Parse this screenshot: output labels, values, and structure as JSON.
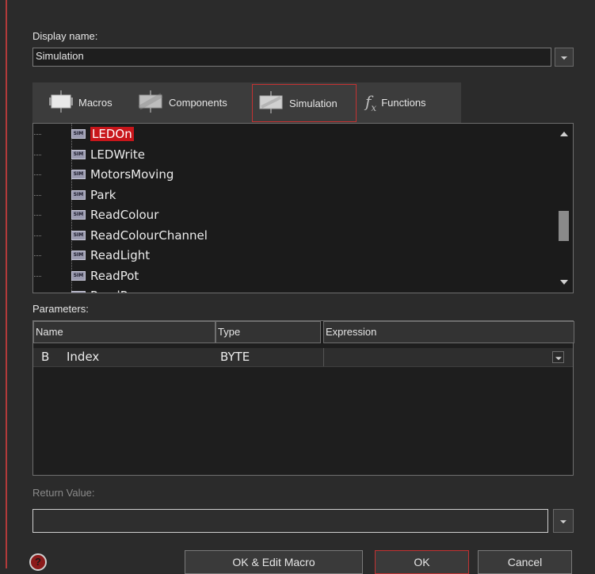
{
  "display_name": {
    "label": "Display name:",
    "value": "Simulation"
  },
  "tabs": [
    {
      "label": "Macros",
      "icon": "macros-icon"
    },
    {
      "label": "Components",
      "icon": "components-icon"
    },
    {
      "label": "Simulation",
      "icon": "simulation-icon",
      "active": true
    },
    {
      "label": "Functions",
      "icon": "functions-icon"
    }
  ],
  "tree": {
    "icon_text": "SIM",
    "items": [
      "LEDOn",
      "LEDWrite",
      "MotorsMoving",
      "Park",
      "ReadColour",
      "ReadColourChannel",
      "ReadLight",
      "ReadPot",
      "ReadProx"
    ],
    "selected": "LEDOn"
  },
  "parameters": {
    "label": "Parameters:",
    "columns": [
      "Name",
      "Type",
      "Expression"
    ],
    "rows": [
      {
        "name": "Index",
        "type": "BYTE",
        "expression": "",
        "type_icon": "B"
      }
    ]
  },
  "return_value": {
    "label": "Return Value:",
    "value": ""
  },
  "buttons": {
    "help": "?",
    "ok_edit": "OK & Edit Macro",
    "ok": "OK",
    "cancel": "Cancel"
  },
  "colors": {
    "accent_red": "#c8161b",
    "background": "#2b2b2b"
  }
}
